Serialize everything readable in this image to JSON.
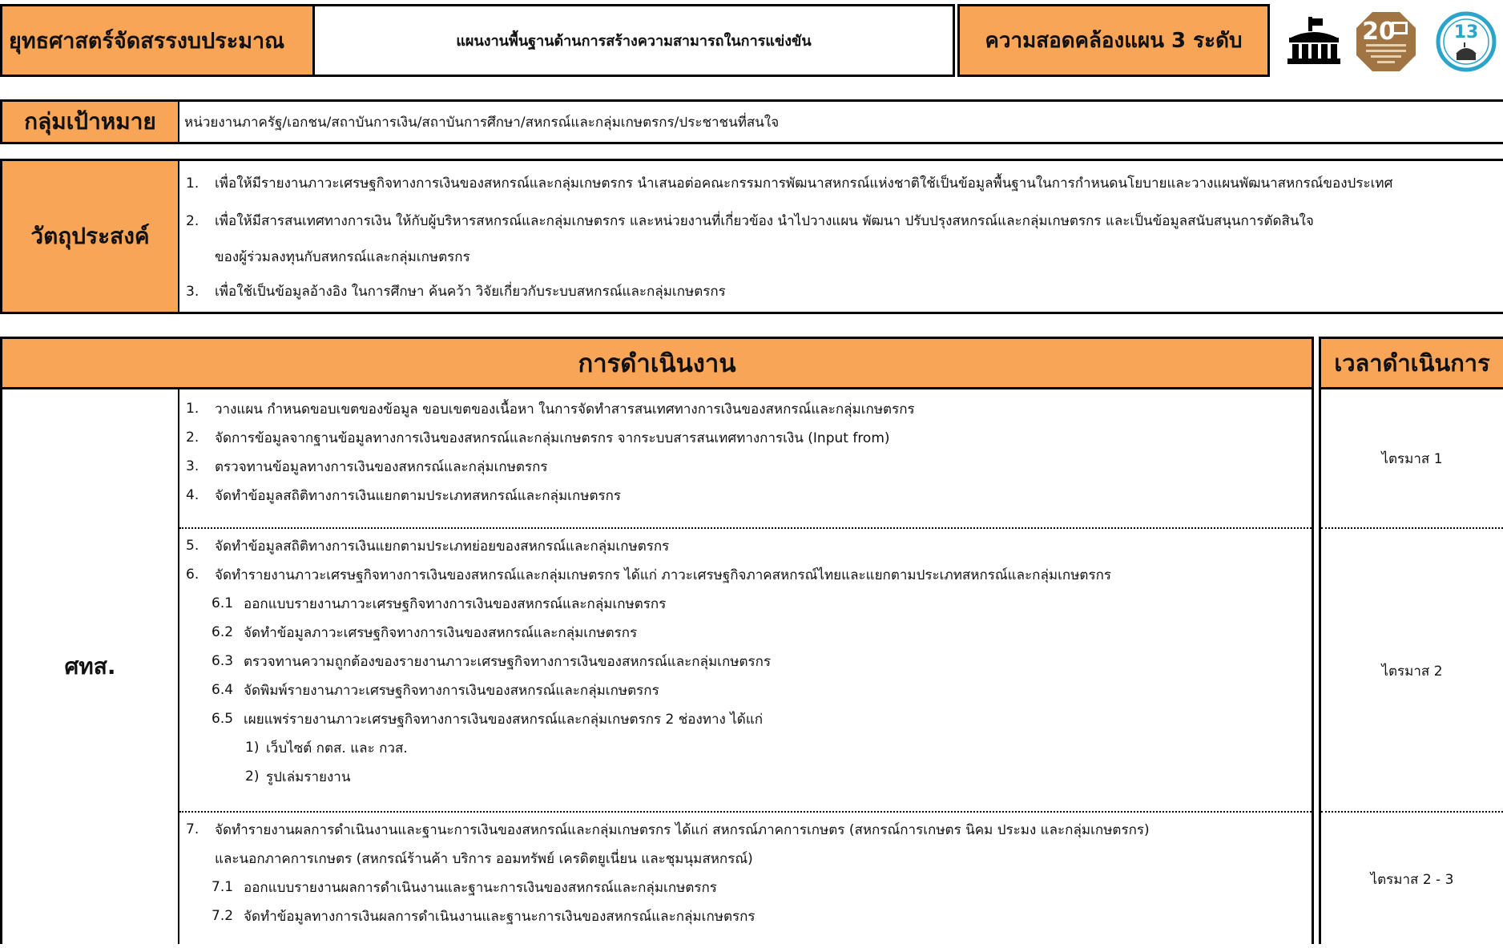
{
  "header": {
    "title": "ยุทธศาสตร์จัดสรรงบประมาณ",
    "plan": "แผนงานพื้นฐานด้านการสร้างความสามารถในการแข่งขัน",
    "alignment": "ความสอดคล้องแผน 3 ระดับ",
    "logos": [
      "institution-logo-icon",
      "20-year-strategy-badge-icon",
      "plan-13-badge-icon"
    ],
    "badge_20": "20",
    "badge_13": "13",
    "colors": {
      "accent": "#f9a557",
      "badge_brown": "#a07443",
      "badge_teal": "#2aa4c9"
    }
  },
  "target_group": {
    "label": "กลุ่มเป้าหมาย",
    "value": "หน่วยงานภาครัฐ/เอกชน/สถาบันการเงิน/สถาบันการศึกษา/สหกรณ์และกลุ่มเกษตรกร/ประชาชนที่สนใจ"
  },
  "objectives": {
    "label": "วัตถุประสงค์",
    "items": [
      {
        "num": "1.",
        "text": "เพื่อให้มีรายงานภาวะเศรษฐกิจทางการเงินของสหกรณ์และกลุ่มเกษตรกร นำเสนอต่อคณะกรรมการพัฒนาสหกรณ์แห่งชาติใช้เป็นข้อมูลพื้นฐานในการกำหนดนโยบายและวางแผนพัฒนาสหกรณ์ของประเทศ"
      },
      {
        "num": "2.",
        "text": "เพื่อให้มีสารสนเทศทางการเงิน ให้กับผู้บริหารสหกรณ์และกลุ่มเกษตรกร และหน่วยงานที่เกี่ยวข้อง นำไปวางแผน พัฒนา ปรับปรุงสหกรณ์และกลุ่มเกษตรกร และเป็นข้อมูลสนับสนุนการตัดสินใจ"
      },
      {
        "num": "",
        "text": "ของผู้ร่วมลงทุนกับสหกรณ์และกลุ่มเกษตรกร"
      },
      {
        "num": "3.",
        "text": "เพื่อใช้เป็นข้อมูลอ้างอิง ในการศึกษา ค้นคว้า วิจัยเกี่ยวกับระบบสหกรณ์และกลุ่มเกษตรกร"
      }
    ]
  },
  "operations": {
    "header": "การดำเนินงาน",
    "time_header": "เวลาดำเนินการ",
    "unit": "ศทส.",
    "groups": [
      {
        "time": "ไตรมาส 1",
        "lines": [
          {
            "num": "1.",
            "text": "วางแผน กำหนดขอบเขตของข้อมูล ขอบเขตของเนื้อหา ในการจัดทำสารสนเทศทางการเงินของสหกรณ์และกลุ่มเกษตรกร"
          },
          {
            "num": "2.",
            "text": "จัดการข้อมูลจากฐานข้อมูลทางการเงินของสหกรณ์และกลุ่มเกษตรกร จากระบบสารสนเทศทางการเงิน (Input from)"
          },
          {
            "num": "3.",
            "text": "ตรวจทานข้อมูลทางการเงินของสหกรณ์และกลุ่มเกษตรกร"
          },
          {
            "num": "4.",
            "text": "จัดทำข้อมูลสถิติทางการเงินแยกตามประเภทสหกรณ์และกลุ่มเกษตรกร"
          }
        ]
      },
      {
        "time": "ไตรมาส 2",
        "lines": [
          {
            "num": "5.",
            "text": "จัดทำข้อมูลสถิติทางการเงินแยกตามประเภทย่อยของสหกรณ์และกลุ่มเกษตรกร"
          },
          {
            "num": "6.",
            "text": "จัดทำรายงานภาวะเศรษฐกิจทางการเงินของสหกรณ์และกลุ่มเกษตรกร ได้แก่ ภาวะเศรษฐกิจภาคสหกรณ์ไทยและแยกตามประเภทสหกรณ์และกลุ่มเกษตรกร"
          },
          {
            "num": "6.1",
            "text": "ออกแบบรายงานภาวะเศรษฐกิจทางการเงินของสหกรณ์และกลุ่มเกษตรกร"
          },
          {
            "num": "6.2",
            "text": "จัดทำข้อมูลภาวะเศรษฐกิจทางการเงินของสหกรณ์และกลุ่มเกษตรกร"
          },
          {
            "num": "6.3",
            "text": "ตรวจทานความถูกต้องของรายงานภาวะเศรษฐกิจทางการเงินของสหกรณ์และกลุ่มเกษตรกร"
          },
          {
            "num": "6.4",
            "text": "จัดพิมพ์รายงานภาวะเศรษฐกิจทางการเงินของสหกรณ์และกลุ่มเกษตรกร"
          },
          {
            "num": "6.5",
            "text": "เผยแพร่รายงานภาวะเศรษฐกิจทางการเงินของสหกรณ์และกลุ่มเกษตรกร 2 ช่องทาง ได้แก่"
          },
          {
            "num": "1)",
            "text": "เว็บไซต์ กตส. และ กวส."
          },
          {
            "num": "2)",
            "text": "รูปเล่มรายงาน"
          }
        ]
      },
      {
        "time": "ไตรมาส 2 - 3",
        "lines": [
          {
            "num": "7.",
            "text": "จัดทำรายงานผลการดำเนินงานและฐานะการเงินของสหกรณ์และกลุ่มเกษตรกร ได้แก่ สหกรณ์ภาคการเกษตร (สหกรณ์การเกษตร นิคม ประมง และกลุ่มเกษตรกร)"
          },
          {
            "num": "",
            "text": "และนอกภาคการเกษตร (สหกรณ์ร้านค้า บริการ ออมทรัพย์ เครดิตยูเนี่ยน และชุมนุมสหกรณ์)"
          },
          {
            "num": "7.1",
            "text": "ออกแบบรายงานผลการดำเนินงานและฐานะการเงินของสหกรณ์และกลุ่มเกษตรกร"
          },
          {
            "num": "7.2",
            "text": "จัดทำข้อมูลทางการเงินผลการดำเนินงานและฐานะการเงินของสหกรณ์และกลุ่มเกษตรกร"
          }
        ]
      }
    ]
  }
}
